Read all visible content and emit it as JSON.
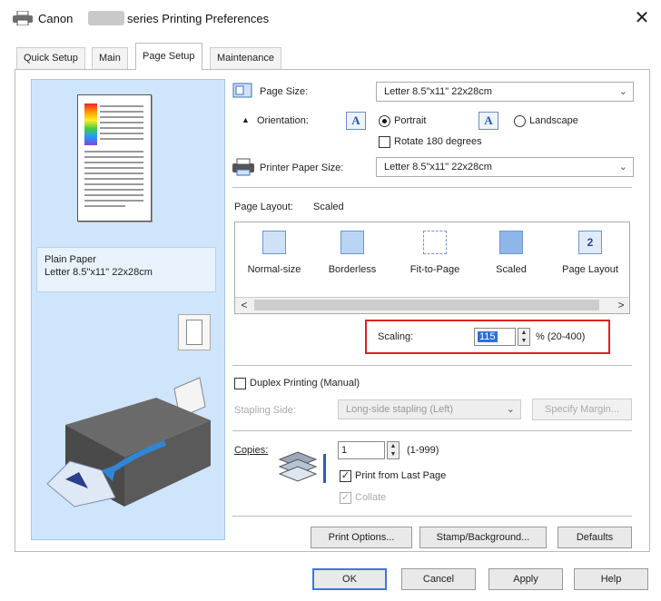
{
  "window": {
    "title_prefix": "Canon",
    "title_suffix": "series Printing Preferences",
    "close_glyph": "✕"
  },
  "tabs": [
    {
      "label": "Quick Setup"
    },
    {
      "label": "Main"
    },
    {
      "label": "Page Setup"
    },
    {
      "label": "Maintenance"
    }
  ],
  "preview": {
    "media_type": "Plain Paper",
    "paper_size": "Letter 8.5\"x11\" 22x28cm"
  },
  "page_size": {
    "label": "Page Size:",
    "value": "Letter 8.5\"x11\" 22x28cm"
  },
  "orientation": {
    "label": "Orientation:",
    "icon_glyph": "A",
    "portrait": "Portrait",
    "landscape": "Landscape",
    "rotate": "Rotate 180 degrees",
    "selected": "Portrait"
  },
  "printer_paper_size": {
    "label": "Printer Paper Size:",
    "value": "Letter 8.5\"x11\" 22x28cm"
  },
  "page_layout": {
    "label": "Page Layout:",
    "value": "Scaled",
    "items": [
      {
        "label": "Normal-size"
      },
      {
        "label": "Borderless"
      },
      {
        "label": "Fit-to-Page"
      },
      {
        "label": "Scaled"
      },
      {
        "label": "Page Layout",
        "badge": "2"
      }
    ],
    "scroll_left": "<",
    "scroll_right": ">"
  },
  "scaling": {
    "label": "Scaling:",
    "value": "115",
    "range": "% (20-400)"
  },
  "duplex": {
    "label": "Duplex Printing (Manual)",
    "stapling_label": "Stapling Side:",
    "stapling_value": "Long-side stapling (Left)",
    "specify_margin": "Specify Margin..."
  },
  "copies": {
    "label": "Copies:",
    "value": "1",
    "range": "(1-999)",
    "print_from_last": "Print from Last Page",
    "collate": "Collate"
  },
  "buttons": {
    "print_options": "Print Options...",
    "stamp_background": "Stamp/Background...",
    "defaults": "Defaults",
    "ok": "OK",
    "cancel": "Cancel",
    "apply": "Apply",
    "help": "Help"
  },
  "colors": {
    "accent_red": "#e02020",
    "preview_bg": "#cfe5fb",
    "selection_blue": "#2f6fd6"
  }
}
